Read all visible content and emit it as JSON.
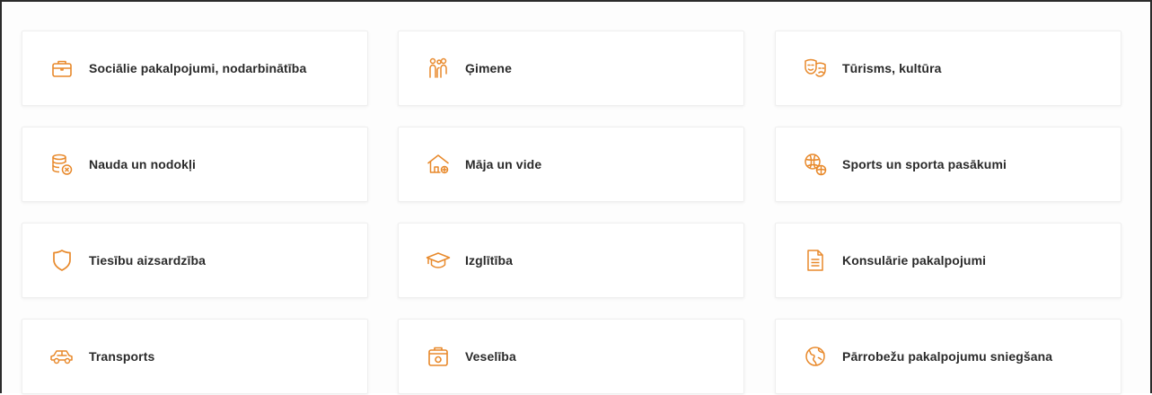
{
  "accent_color": "#e8892b",
  "categories": [
    {
      "label": "Sociālie pakalpojumi, nodarbinātība",
      "icon": "briefcase-icon"
    },
    {
      "label": "Ģimene",
      "icon": "family-icon"
    },
    {
      "label": "Tūrisms, kultūra",
      "icon": "theater-masks-icon"
    },
    {
      "label": "Nauda un nodokļi",
      "icon": "coins-icon"
    },
    {
      "label": "Māja un vide",
      "icon": "house-icon"
    },
    {
      "label": "Sports un sporta pasākumi",
      "icon": "sports-balls-icon"
    },
    {
      "label": "Tiesību aizsardzība",
      "icon": "shield-icon"
    },
    {
      "label": "Izglītība",
      "icon": "graduation-cap-icon"
    },
    {
      "label": "Konsulārie pakalpojumi",
      "icon": "document-icon"
    },
    {
      "label": "Transports",
      "icon": "car-icon"
    },
    {
      "label": "Veselība",
      "icon": "first-aid-kit-icon"
    },
    {
      "label": "Pārrobežu pakalpojumu sniegšana",
      "icon": "globe-icon"
    }
  ]
}
